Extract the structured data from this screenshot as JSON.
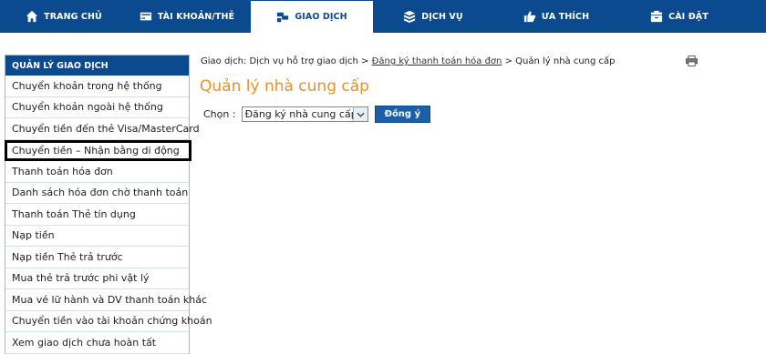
{
  "nav": {
    "tabs": [
      {
        "label": "TRANG CHỦ",
        "icon": "home-icon"
      },
      {
        "label": "TÀI KHOẢN/THẺ",
        "icon": "card-icon"
      },
      {
        "label": "GIAO DỊCH",
        "icon": "transaction-icon"
      },
      {
        "label": "DỊCH VỤ",
        "icon": "services-icon"
      },
      {
        "label": "ƯA THÍCH",
        "icon": "favorite-icon"
      },
      {
        "label": "CÀI ĐẶT",
        "icon": "settings-icon"
      }
    ],
    "active_tab": "GIAO DỊCH"
  },
  "sidebar": {
    "title": "QUẢN LÝ GIAO DỊCH",
    "items": [
      {
        "label": "Chuyển khoản trong hệ thống"
      },
      {
        "label": "Chuyển khoản ngoài hệ thống"
      },
      {
        "label": "Chuyển tiền đến thẻ Visa/MasterCard"
      },
      {
        "label": "Chuyển tiền – Nhận bằng di động"
      },
      {
        "label": "Thanh toán hóa đơn"
      },
      {
        "label": "Danh sách hóa đơn chờ thanh toán"
      },
      {
        "label": "Thanh toán Thẻ tín dụng"
      },
      {
        "label": "Nạp tiền"
      },
      {
        "label": "Nạp tiền Thẻ trả trước"
      },
      {
        "label": "Mua thẻ trả trước phi vật lý"
      },
      {
        "label": "Mua vé lữ hành và DV thanh toán khác"
      },
      {
        "label": "Chuyển tiền vào tài khoản chứng khoán"
      },
      {
        "label": "Xem giao dịch chưa hoàn tất"
      }
    ]
  },
  "breadcrumb": {
    "part1": "Giao dịch: Dịch vụ hỗ trợ giao dịch >",
    "link": "Đăng ký thanh toán hóa đơn",
    "part2": "> Quản lý nhà cung cấp"
  },
  "page": {
    "title": "Quản lý nhà cung cấp",
    "select_label": "Chọn :",
    "select_value": "Đăng ký nhà cung cấp",
    "submit_label": "Đồng ý"
  },
  "colors": {
    "nav_bg": "#0b4a8e",
    "title": "#e8912b",
    "button": "#1a5fa8"
  }
}
